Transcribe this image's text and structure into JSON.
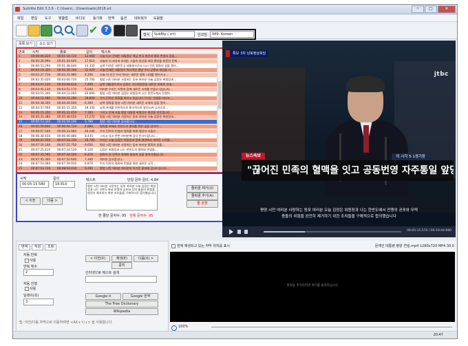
{
  "window": {
    "title": "Subtitle Edit 3.3.6 - C:\\Users\\...\\Downloads\\2018.srt",
    "minimize": "─",
    "maximize": "□",
    "close": "✕"
  },
  "menu": [
    "파일",
    "편집",
    "도구",
    "맞춤법",
    "비디오",
    "동기화",
    "번역",
    "옵션",
    "네트워크",
    "도움말"
  ],
  "toolbar": {
    "icons": [
      "new-file-icon",
      "open-folder-icon",
      "save-icon",
      "find-icon",
      "find-next-icon",
      "replace-icon",
      "spell-check-icon",
      "help-icon",
      "waveform-icon",
      "video-icon"
    ],
    "format_label": "형식",
    "format_value": "SubRip (.srt)",
    "encoding_label": "인코딩",
    "encoding_value": "949: Korean"
  },
  "tabs": {
    "list_view": "목록 보기",
    "source_view": "소스 보기"
  },
  "grid": {
    "headers": [
      "번호",
      "시작",
      "종료",
      "길이",
      "텍스트"
    ],
    "rows": [
      [
        "1",
        "00:00:06.820",
        "00:01:10.720",
        "13.900",
        "오늘 다시 문재인 대통령은 북남 한국 발전과 평화 번영의 길을…"
      ],
      [
        "2",
        "00:00:26.990",
        "00:01:44.600",
        "17.610",
        "오늘의 이 자유의 토대는 그들의 헌신을 바탕 평양을 방문한 문재…"
      ],
      [
        "3",
        "00:00:53.290",
        "00:01:48.640",
        "14.350",
        "남북 어려운 대한민국 대통령으로서 다시 민족 평화의 길을 열어…"
      ],
      [
        "4",
        "00:02:14.320",
        "00:02:26.340",
        "12.020",
        "오늘 문재인 대통령이 역사적인 평양 수뇌 상봉과 회담을 가…"
      ],
      [
        "5",
        "00:02:27.710",
        "00:02:31.980",
        "4.200",
        "오늘 이 순간 우리 역사는 새로운 평화 시대를 열어가고…"
      ],
      [
        "6",
        "00:02:35.020",
        "00:03:00.720",
        "25.700",
        "평양 시민 여러분 사랑하는 동포 여러분 오늘 김정은 위원장과…"
      ],
      [
        "7",
        "00:03:01.120",
        "00:03:08.610",
        "7.490",
        "남북 대통령으로서 김정은 국무위원장을 새로운 미래로 안내…"
      ],
      [
        "8",
        "00:03:45.130",
        "00:03:51.170",
        "6.040",
        "여러분 우리는 이렇게 함께 새로운 시대를 만들고 있습니다…"
      ],
      [
        "9",
        "00:03:51.340",
        "00:04:12.000",
        "20.660",
        "평양 시민 여러분 김정은 위원장과 나는 한반도에서 전쟁의…"
      ],
      [
        "10",
        "00:04:12.480",
        "00:04:31.280",
        "18.800",
        "우리 민족은 평화를 바라고 있습니다 우리는 번영을 바라고…"
      ],
      [
        "11",
        "00:04:38.300",
        "00:04:44.600",
        "6.300",
        "남북 평화를 평양 시민 여러분 새로운 시대의 길을 열어…"
      ],
      [
        "12",
        "00:04:57.000",
        "00:05:15.350",
        "18.350",
        "남북 관계를 전면적으로 확기적으로 발전시켜 나가기로…"
      ],
      [
        "13",
        "00:05:15.350",
        "00:05:22.450",
        "7.100",
        "그리고 후에 가을 평양 대통령 위원장은 평양을 방문합니다…"
      ],
      [
        "14",
        "00:05:31.380",
        "00:05:48.650",
        "17.270",
        "평양 시민 여러분 사랑하는 동포 여러분 오늘 김정은 위원장과…"
      ],
      [
        "15",
        "00:05:53.320",
        "00:05:59.100",
        "5.780",
        "평양 시민 여러분 감사합니다…"
      ],
      [
        "16",
        "00:05:59.840",
        "00:06:04.720",
        "4.880",
        "평화를 위해서 한반도의 평화를 위한 길을 걸어가…"
      ],
      [
        "17",
        "00:06:07.540",
        "00:06:33.980",
        "26.440",
        "우리 민족의 번영과 평화를 위해 평양과 서울은…"
      ],
      [
        "18",
        "00:06:38.450",
        "00:06:46.880",
        "8.430",
        "그리고 다시 한번 여러분께 감사 인사드립니다…"
      ],
      [
        "19",
        "00:06:47.550",
        "00:07:04.330",
        "16.780",
        "우리는 오늘 김정은 위원장과 함께 평양에서 새로운 시작을…"
      ],
      [
        "20",
        "00:07:16.100",
        "00:07:25.750",
        "9.650",
        "평양 시민 여러분 사랑하는 동포 여러분 평화의 길을…"
      ],
      [
        "21",
        "00:07:25.410",
        "00:07:34.530",
        "9.120",
        "김정은 위원장과 나는 한반도의 평화와 번영을…"
      ],
      [
        "22",
        "00:07:35.590",
        "00:07:44.000",
        "8.410",
        "평화의 길 민족의 화해와 통일의 길을 열어가겠습니다…"
      ],
      [
        "23",
        "00:07:45.300",
        "00:07:52.640",
        "7.340",
        "여러분 감사합니다…"
      ],
      [
        "24",
        "00:07:53.060",
        "00:07:59.930",
        "6.870",
        "우리 민족의 평화와 번영을 위한 새로운 시작…"
      ],
      [
        "25",
        "00:07:53.720",
        "00:08:03.010",
        "9.290",
        "평양 시민 여러분 여러분의 뜨거운 환대에 감사드립니다…"
      ]
    ],
    "selected_row_index": 14
  },
  "editor": {
    "start_label": "시작",
    "start_value": "00:05:15.580",
    "duration_label": "길이",
    "duration_value": "18.810",
    "text_label": "텍스트",
    "single_line_label": "단일 문자 길이: 4.84",
    "text_value": "평양 시민 여러분 사랑하는 동포 여러분 오늘 김정은 위원장과 나는 한반도에서 전쟁의 공포와 무력 충돌의 위험을 완전히 제거하기 위한 조치들을 구체적으로 합의했습니다",
    "prev_button": "< 이전",
    "next_button": "다음 >",
    "insert_button": "줄바꿈 제거(U)",
    "split_button": "줄바꿈 추가(A)",
    "unbreak_button": "줄 분할",
    "total_length": "한 줄당 문자수: 95",
    "total_chars": "전체 문자수: 95"
  },
  "video": {
    "badge": "특보",
    "badge_channel": "3차 남북정상회담",
    "logo": "jtbc",
    "news_flash": "뉴스속보",
    "side_caption": "이 시각 5·1경기장",
    "headline": "\"끊어진 민족의 혈맥을 잇고 공동번영 자주통일 앞당기자\"",
    "subtitle_line1": "평양 시민 여러분 사랑하는 동포 여러분 오늘 김정은 위원장과 나는 한반도에서 전쟁의 공포와 무력",
    "subtitle_line2": "충돌의 위험을 완전히 제거하기 위한 조치들을 구체적으로 합의했습니다",
    "time": "00:05:15.570 / 00:10:44.680"
  },
  "lower_tabs": [
    "번역",
    "작성",
    "조정"
  ],
  "lower": {
    "auto_repeat_label": "자동 반복",
    "auto_repeat_check": "사용",
    "repeat_count_label": "반복 횟수",
    "repeat_count_value": "2",
    "auto_continue_label": "자동 진행",
    "auto_continue_check": "사용",
    "delay_label": "딜레이(초)",
    "delay_value": "3",
    "btn_prev": "< 이전(V)",
    "btn_play": "재생(E)",
    "btn_next": "다음(X) >",
    "btn_stop": "중지",
    "search_label": "인터넷으로 텍스트 검색",
    "btn_google_it": "Google it",
    "btn_google_translate": "Google 번역",
    "btn_free_dictionary": "The Free Dictionary",
    "btn_wikipedia": "Wikipedia",
    "tip": "팁: 이전/다음 자막으로 이동하려면 <Alt+↑/↓> 을 사용합니다."
  },
  "audio": {
    "checkbox_label": "현재 재생되고 있는 자막 위치를 표시",
    "file_info": "문재인 대통령 평양 연설.mp4 1280x720 MP4 30.0",
    "placeholder": "파형을 추가하려면 여기를 클릭하십시오",
    "zoom": "100%"
  },
  "status": {
    "time": "20:47"
  }
}
